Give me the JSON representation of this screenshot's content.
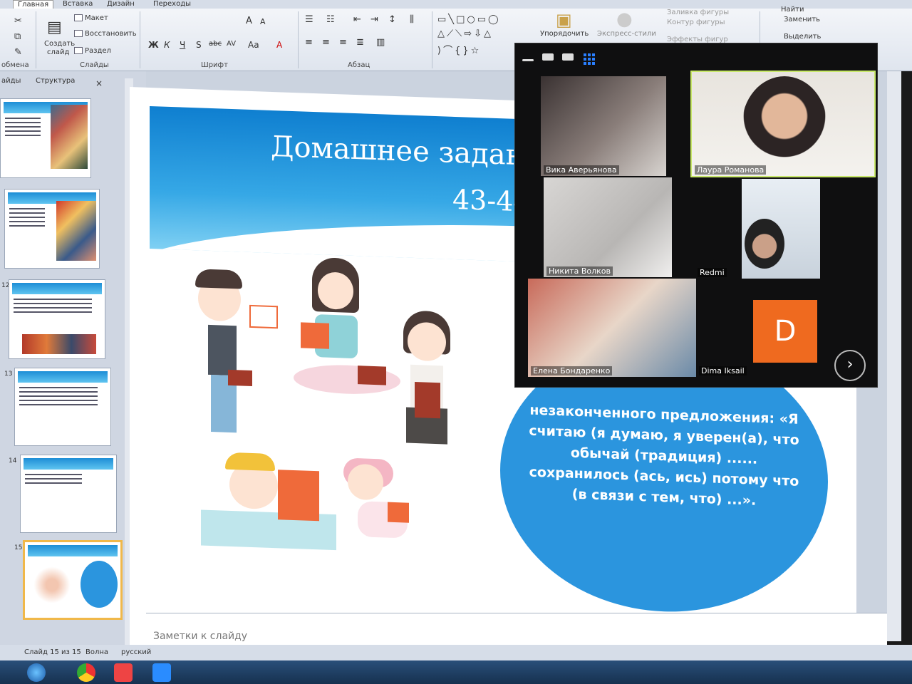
{
  "ribbon": {
    "tabs": [
      "Главная",
      "Вставка",
      "Дизайн",
      "Переходы"
    ],
    "clipboard_label": "обмена",
    "slides": {
      "layout": "Макет",
      "reset": "Восстановить",
      "new_slide_1": "Создать",
      "new_slide_2": "слайд",
      "section": "Раздел",
      "group_label": "Слайды"
    },
    "font": {
      "grow": "A",
      "shrink": "A",
      "bold": "Ж",
      "italic": "К",
      "underline": "Ч",
      "strike": "S",
      "abc": "abc",
      "spacing": "AV",
      "case": "Aa",
      "color": "A",
      "group_label": "Шрифт"
    },
    "paragraph": {
      "group_label": "Абзац"
    },
    "drawing": {
      "arrange": "Упорядочить",
      "quick_styles": "Экспресс-стили",
      "fill": "Заливка фигуры",
      "outline": "Контур фигуры",
      "effects": "Эффекты фигур"
    },
    "editing": {
      "find": "Найти",
      "replace": "Заменить",
      "select": "Выделить"
    }
  },
  "left_panel": {
    "tabs": [
      "айды",
      "Структура"
    ],
    "close": "×",
    "slide_numbers": [
      "12",
      "13",
      "14",
      "15"
    ]
  },
  "slide": {
    "title": "Домашнее задание",
    "subtitle": "43-44",
    "circle_text": "незаконченного предложения: «Я считаю (я думаю, я уверен(а), что обычай (традиция) ...... сохранилось (ась, ись) потому что (в связи с тем, что) ...»."
  },
  "notes": {
    "placeholder": "Заметки к слайду"
  },
  "status": {
    "slide_count": "Слайд 15 из 15",
    "theme": "Волна",
    "language": "русский"
  },
  "call": {
    "participants": [
      {
        "name": "Вика Аверьянова"
      },
      {
        "name": "Лаура Романова"
      },
      {
        "name": "Никита Волков"
      },
      {
        "name": "Redmi"
      },
      {
        "name": "Елена Бондаренко"
      },
      {
        "name": "Dima Iksail",
        "initial": "D"
      }
    ],
    "next": "›"
  },
  "colors": {
    "slide_blue": "#2b95de",
    "avatar_orange": "#ef6a1f",
    "active_speaker": "#c8e86a",
    "accent_grid": "#2a7fff"
  }
}
